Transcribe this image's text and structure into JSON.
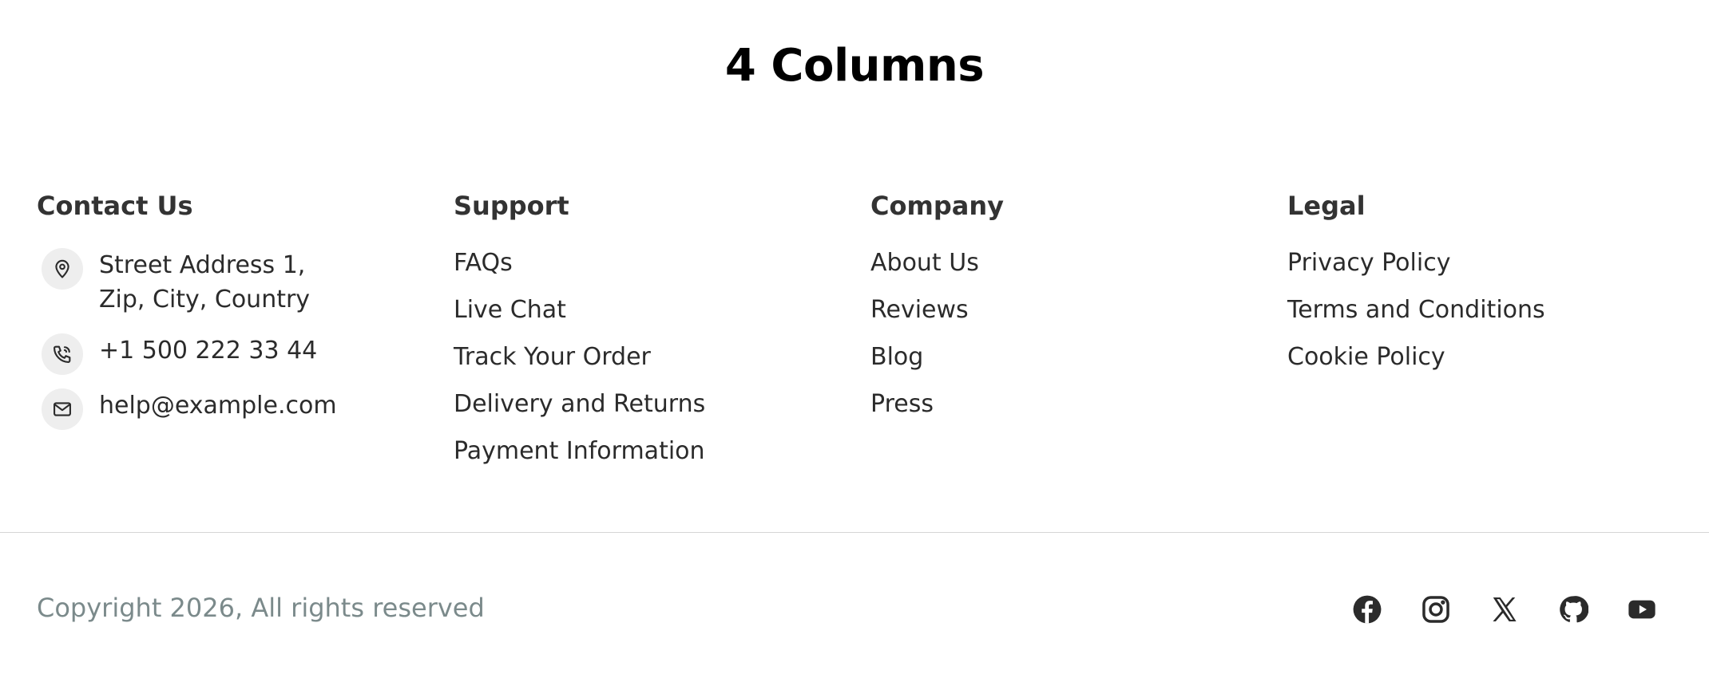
{
  "page": {
    "title": "4 Columns"
  },
  "contact": {
    "heading": "Contact Us",
    "address_line1": "Street Address 1,",
    "address_line2": "Zip, City, Country",
    "phone": "+1 500 222 33 44",
    "email": "help@example.com",
    "icons": [
      "map-pin-icon",
      "phone-icon",
      "mail-icon"
    ]
  },
  "support": {
    "heading": "Support",
    "links": [
      "FAQs",
      "Live Chat",
      "Track Your Order",
      "Delivery and Returns",
      "Payment Information"
    ]
  },
  "company": {
    "heading": "Company",
    "links": [
      "About Us",
      "Reviews",
      "Blog",
      "Press"
    ]
  },
  "legal": {
    "heading": "Legal",
    "links": [
      "Privacy Policy",
      "Terms and Conditions",
      "Cookie Policy"
    ]
  },
  "footer": {
    "copyright": "Copyright 2026, All rights reserved",
    "social_icons": [
      "facebook-icon",
      "instagram-icon",
      "x-icon",
      "github-icon",
      "youtube-icon"
    ]
  },
  "colors": {
    "text": "#2b2b2b",
    "muted": "#7b8a8b",
    "icon_bg": "#eeeeee",
    "divider": "#d6d6d6"
  }
}
